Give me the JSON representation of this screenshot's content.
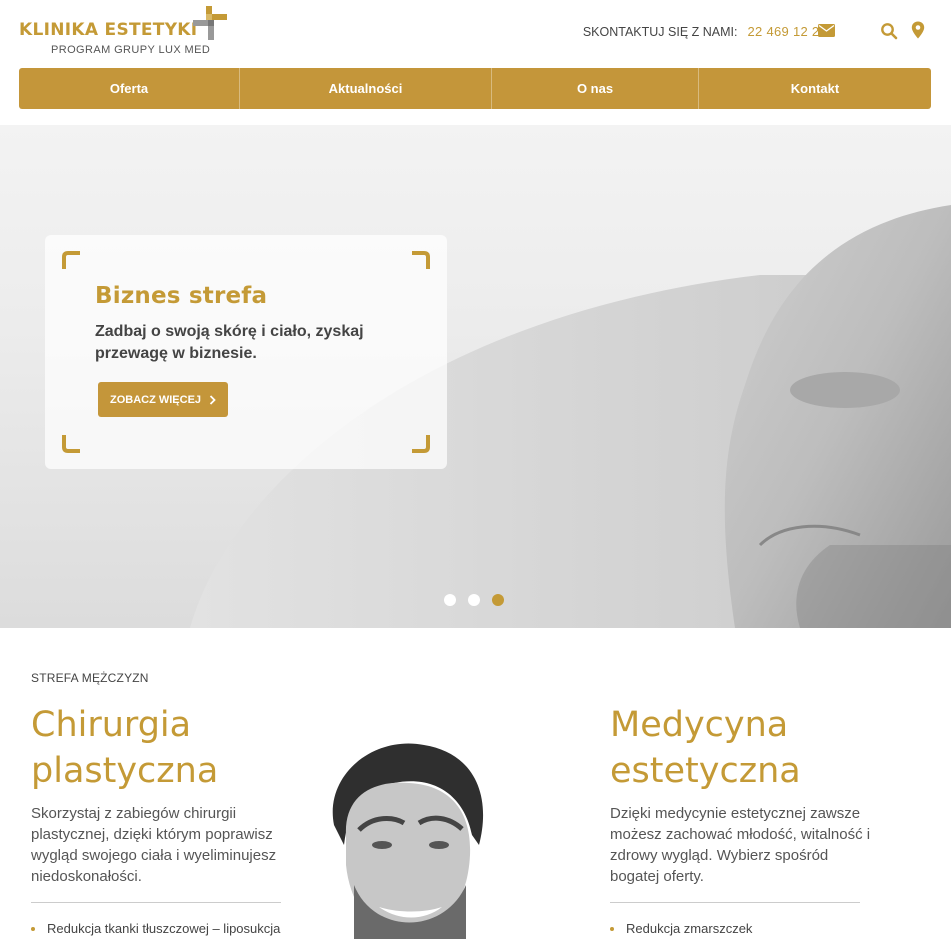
{
  "header": {
    "logo_title": "KLINIKA ESTETYKI",
    "logo_subtitle": "PROGRAM GRUPY LUX MED",
    "contact_label": "SKONTAKTUJ SIĘ Z NAMI:",
    "phone": "22 469 12 29",
    "icons": [
      "mail-icon",
      "search-icon",
      "map-pin-icon"
    ]
  },
  "nav": {
    "items": [
      {
        "label": "Oferta"
      },
      {
        "label": "Aktualności"
      },
      {
        "label": "O nas"
      },
      {
        "label": "Kontakt"
      }
    ]
  },
  "hero": {
    "title": "Biznes strefa",
    "text": "Zadbaj o swoją skórę i ciało, zyskaj przewagę w biznesie.",
    "button_label": "ZOBACZ WIĘCEJ",
    "slides_count": 3,
    "active_slide": 3
  },
  "section": {
    "label": "STREFA MĘŻCZYZN",
    "left": {
      "title_line1": "Chirurgia",
      "title_line2": "plastyczna",
      "text": "Skorzystaj z zabiegów chirurgii plastycznej, dzięki którym poprawisz wygląd swojego ciała i wyeliminujesz niedoskonałości.",
      "list": [
        "Redukcja tkanki tłuszczowej – liposukcja"
      ]
    },
    "right": {
      "title_line1": "Medycyna",
      "title_line2": "estetyczna",
      "text": "Dzięki medycynie estetycznej zawsze możesz zachować młodość, witalność i zdrowy wygląd. Wybierz spośród bogatej oferty.",
      "list": [
        "Redukcja zmarszczek"
      ]
    }
  },
  "colors": {
    "accent": "#c49a36",
    "nav_bg": "#c4963a",
    "text": "#444444"
  }
}
